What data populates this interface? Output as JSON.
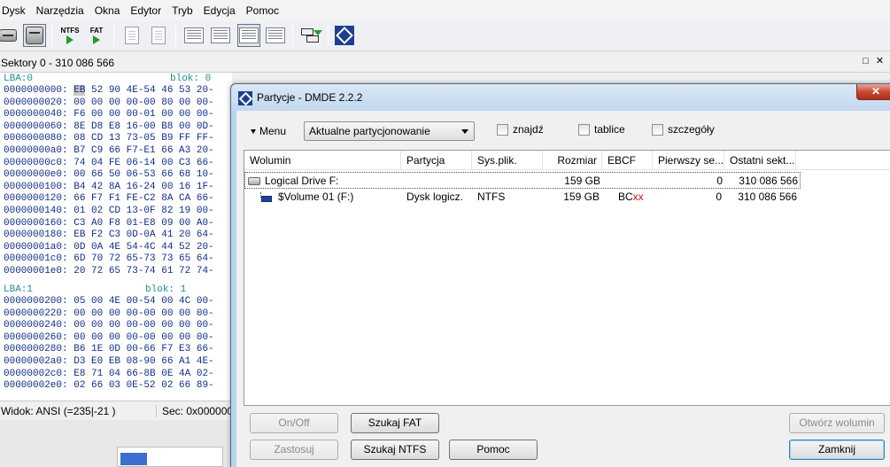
{
  "menubar": {
    "items": [
      "Dysk",
      "Narzędzia",
      "Okna",
      "Edytor",
      "Tryb",
      "Edycja",
      "Pomoc"
    ]
  },
  "toolbar": {
    "ntfs_label": "NTFS",
    "fat_label": "FAT",
    "icons": [
      "drive-icon",
      "drive-selected-icon",
      "ntfs-icon",
      "fat-icon",
      "document-icon",
      "document-new-icon",
      "list-icon",
      "list-detail-icon",
      "list-grid-icon",
      "search-list-icon",
      "copy-arrow-icon",
      "dmde-logo-icon"
    ]
  },
  "sector_panel": {
    "title": "Sektory 0 - 310 086 566",
    "maximize_glyph": "□",
    "close_glyph": "✕"
  },
  "hex": {
    "lba0": {
      "label": "LBA:0",
      "block": "blok: 0"
    },
    "rows0": [
      [
        "0000000000:",
        "EB",
        " 52 90 4E-54 46 53 20-"
      ],
      [
        "0000000020:",
        "",
        "00 00 00 00-00 80 00 00-"
      ],
      [
        "0000000040:",
        "",
        "F6 00 00 00-01 00 00 00-"
      ],
      [
        "0000000060:",
        "",
        "8E D8 E8 16-00 B8 00 0D-"
      ],
      [
        "0000000080:",
        "",
        "08 CD 13 73-05 B9 FF FF-"
      ],
      [
        "00000000a0:",
        "",
        "B7 C9 66 F7-E1 66 A3 20-"
      ],
      [
        "00000000c0:",
        "",
        "74 04 FE 06-14 00 C3 66-"
      ],
      [
        "00000000e0:",
        "",
        "00 66 50 06-53 66 68 10-"
      ],
      [
        "0000000100:",
        "",
        "B4 42 8A 16-24 00 16 1F-"
      ],
      [
        "0000000120:",
        "",
        "66 F7 F1 FE-C2 8A CA 66-"
      ],
      [
        "0000000140:",
        "",
        "01 02 CD 13-0F 82 19 00-"
      ],
      [
        "0000000160:",
        "",
        "C3 A0 F8 01-E8 09 00 A0-"
      ],
      [
        "0000000180:",
        "",
        "EB F2 C3 0D-0A 41 20 64-"
      ],
      [
        "00000001a0:",
        "",
        "0D 0A 4E 54-4C 44 52 20-"
      ],
      [
        "00000001c0:",
        "",
        "6D 70 72 65-73 73 65 64-"
      ],
      [
        "00000001e0:",
        "",
        "20 72 65 73-74 61 72 74-"
      ]
    ],
    "lba1": {
      "label": "LBA:1",
      "block": "blok: 1"
    },
    "rows1": [
      [
        "0000000200:",
        "",
        "05 00 4E 00-54 00 4C 00-"
      ],
      [
        "0000000220:",
        "",
        "00 00 00 00-00 00 00 00-"
      ],
      [
        "0000000240:",
        "",
        "00 00 00 00-00 00 00 00-"
      ],
      [
        "0000000260:",
        "",
        "00 00 00 00-00 00 00 00-"
      ],
      [
        "0000000280:",
        "",
        "B6 1E 0D 00-66 F7 E3 66-"
      ],
      [
        "00000002a0:",
        "",
        "D3 E0 EB 08-90 66 A1 4E-"
      ],
      [
        "00000002c0:",
        "",
        "E8 71 04 66-8B 0E 4A 02-"
      ],
      [
        "00000002e0:",
        "",
        "02 66 03 0E-52 02 66 89-"
      ]
    ],
    "status_left": "Widok: ANSI (=235|-21 )",
    "status_right": "Sec: 0x0000000"
  },
  "dialog": {
    "title": "Partycje - DMDE 2.2.2",
    "close_glyph": "✕",
    "menu_label": "Menu",
    "combo_value": "Aktualne partycjonowanie",
    "checkboxes": [
      {
        "label": "znajdź",
        "checked": false
      },
      {
        "label": "tablice",
        "checked": false
      },
      {
        "label": "szczegóły",
        "checked": false
      }
    ],
    "columns": [
      "Wolumin",
      "Partycja",
      "Sys.plik.",
      "Rozmiar",
      "EBCF",
      "Pierwszy se...",
      "Ostatni sekt..."
    ],
    "rows": [
      {
        "volume": "Logical Drive F:",
        "partition": "",
        "fs": "",
        "size": "159 GB",
        "ebcf_bc": "",
        "ebcf_xx": "",
        "first": "0",
        "last": "310 086 566"
      },
      {
        "volume": "$Volume 01 (F:)",
        "partition": "Dysk logicz.",
        "fs": "NTFS",
        "size": "159 GB",
        "ebcf_bc": "BC",
        "ebcf_xx": "xx",
        "first": "0",
        "last": "310 086 566"
      }
    ],
    "buttons": {
      "onoff": "On/Off",
      "apply": "Zastosuj",
      "search_fat": "Szukaj FAT",
      "search_ntfs": "Szukaj NTFS",
      "help": "Pomoc",
      "open_volume": "Otwórz wolumin",
      "close": "Zamknij"
    }
  }
}
